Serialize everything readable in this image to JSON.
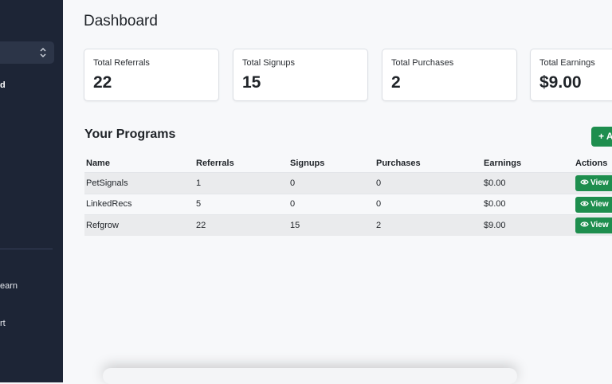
{
  "sidebar": {
    "items": [
      {
        "label": "d",
        "active": true
      },
      {
        "label": ""
      },
      {
        "label": "earn"
      },
      {
        "label": "rt"
      }
    ]
  },
  "page": {
    "title": "Dashboard"
  },
  "stats": [
    {
      "label": "Total Referrals",
      "value": "22"
    },
    {
      "label": "Total Signups",
      "value": "15"
    },
    {
      "label": "Total Purchases",
      "value": "2"
    },
    {
      "label": "Total Earnings",
      "value": "$9.00"
    }
  ],
  "programs": {
    "title": "Your Programs",
    "add_label": "+ Add",
    "columns": [
      "Name",
      "Referrals",
      "Signups",
      "Purchases",
      "Earnings",
      "Actions"
    ],
    "view_label": "View",
    "rows": [
      {
        "name": "PetSignals",
        "referrals": "1",
        "signups": "0",
        "purchases": "0",
        "earnings": "$0.00"
      },
      {
        "name": "LinkedRecs",
        "referrals": "5",
        "signups": "0",
        "purchases": "0",
        "earnings": "$0.00"
      },
      {
        "name": "Refgrow",
        "referrals": "22",
        "signups": "15",
        "purchases": "2",
        "earnings": "$9.00"
      }
    ]
  },
  "colors": {
    "sidebar_bg": "#1d2536",
    "accent_green": "#1e8e4e",
    "page_bg": "#f7f8fa"
  }
}
